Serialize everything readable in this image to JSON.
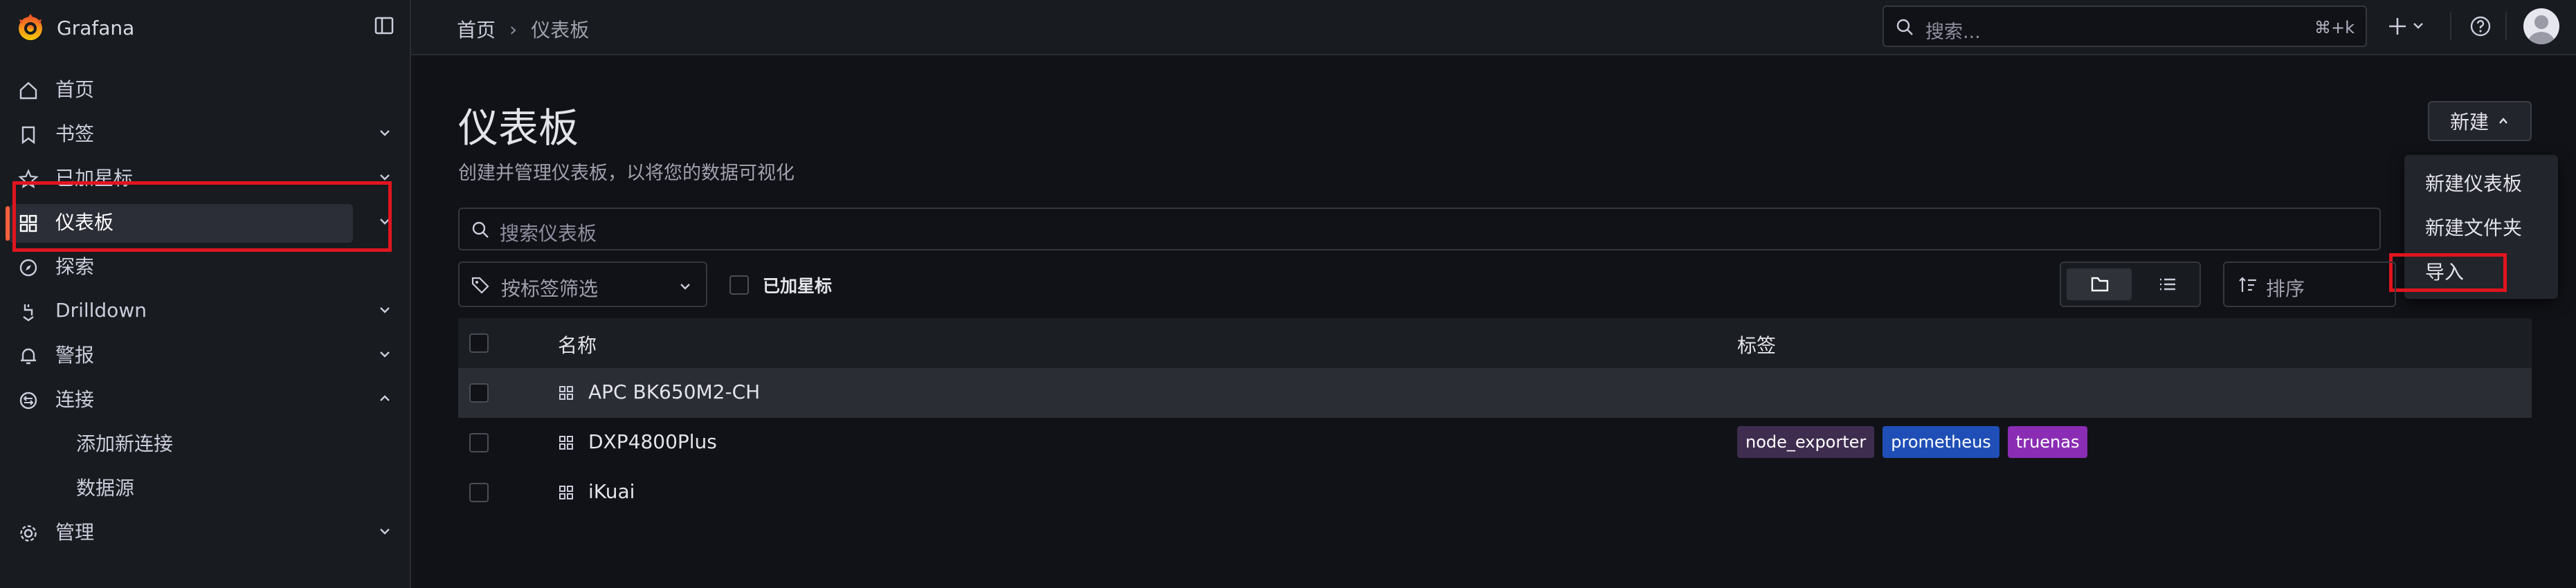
{
  "app": {
    "name": "Grafana"
  },
  "sidebar": {
    "items": [
      {
        "label": "首页",
        "icon": "home-icon"
      },
      {
        "label": "书签",
        "icon": "bookmark-icon"
      },
      {
        "label": "已加星标",
        "icon": "star-icon"
      },
      {
        "label": "仪表板",
        "icon": "apps-icon",
        "active": true
      },
      {
        "label": "探索",
        "icon": "compass-icon"
      },
      {
        "label": "Drilldown",
        "icon": "drilldown-icon"
      },
      {
        "label": "警报",
        "icon": "bell-icon"
      },
      {
        "label": "连接",
        "icon": "connections-icon",
        "expanded": true
      },
      {
        "label": "添加新连接",
        "sub": true
      },
      {
        "label": "数据源",
        "sub": true
      },
      {
        "label": "管理",
        "icon": "gear-icon"
      }
    ],
    "active_color": "#f55f3e"
  },
  "topbar": {
    "breadcrumb": {
      "home": "首页",
      "separator": "›",
      "current": "仪表板"
    },
    "search": {
      "placeholder": "搜索...",
      "shortcut": "⌘+k"
    }
  },
  "page": {
    "title": "仪表板",
    "subtitle": "创建并管理仪表板，以将您的数据可视化",
    "new_button": "新建",
    "new_menu": [
      "新建仪表板",
      "新建文件夹",
      "导入"
    ],
    "search_placeholder": "搜索仪表板",
    "tag_filter_placeholder": "按标签筛选",
    "starred_label": "已加星标",
    "sort_placeholder": "排序"
  },
  "table": {
    "columns": {
      "name": "名称",
      "tags": "标签"
    },
    "rows": [
      {
        "name": "APC BK650M2-CH",
        "tags": []
      },
      {
        "name": "DXP4800Plus",
        "tags": [
          {
            "label": "node_exporter",
            "color": "#4a2f5c"
          },
          {
            "label": "prometheus",
            "color": "#1f4fb6"
          },
          {
            "label": "truenas",
            "color": "#8a2db4"
          }
        ]
      },
      {
        "name": "iKuai",
        "tags": []
      }
    ]
  },
  "highlight_color": "#e0151f"
}
